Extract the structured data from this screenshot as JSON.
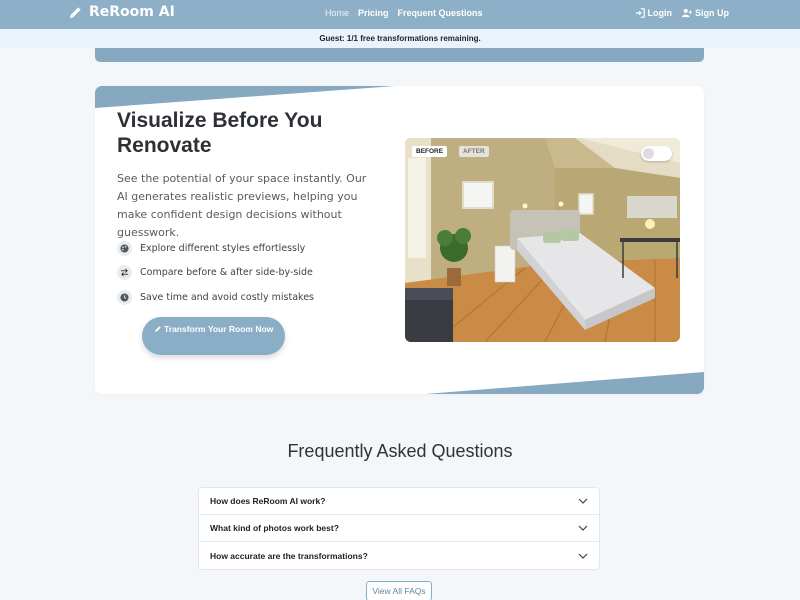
{
  "nav": {
    "brand": "ReRoom AI",
    "links": [
      "Home",
      "Pricing",
      "Frequent Questions"
    ],
    "login": "Login",
    "signup": "Sign Up"
  },
  "guest_notice": "Guest: 1/1 free transformations remaining.",
  "hero": {
    "title": "Visualize Before You Renovate",
    "subtitle": "See the potential of your space instantly. Our AI generates realistic previews, helping you make confident design decisions without guesswork.",
    "features": [
      {
        "icon": "palette-icon",
        "text": "Explore different styles effortlessly"
      },
      {
        "icon": "swap-arrows-icon",
        "text": "Compare before & after side-by-side"
      },
      {
        "icon": "clock-icon",
        "text": "Save time and avoid costly mistakes"
      }
    ],
    "cta": "Transform Your Room Now",
    "preview": {
      "before_label": "BEFORE",
      "after_label": "AFTER",
      "toggle_on": false
    }
  },
  "faq": {
    "title": "Frequently Asked Questions",
    "items": [
      "How does ReRoom AI work?",
      "What kind of photos work best?",
      "How accurate are the transformations?"
    ],
    "view_all": "View All FAQs"
  },
  "colors": {
    "brand": "#8db0c8",
    "accent": "#86a8c0",
    "guest_bar": "#eaf2fb",
    "page_bg": "#f4f7fa"
  }
}
